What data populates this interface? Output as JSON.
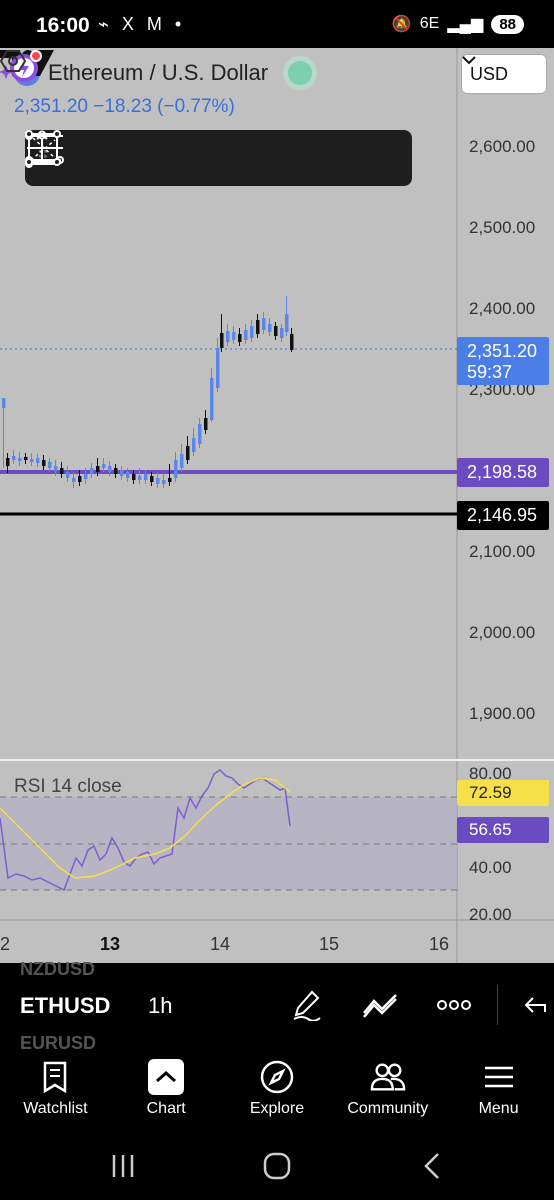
{
  "status_bar": {
    "time": "16:00",
    "left_icons": "⌁ X M •",
    "network": "6E",
    "battery": "88"
  },
  "symbol": {
    "title": "Ethereum / U.S. Dollar",
    "price_change": "2,351.20  −18.23 (−0.77%)",
    "currency": "USD"
  },
  "toolbar": {
    "tools": [
      "range-tool-icon",
      "fib-extension-icon",
      "parallel-lines-icon",
      "horizontal-ray-icon",
      "fib-channel-icon",
      "rectangle-icon"
    ]
  },
  "price_axis": {
    "labels": [
      "2,600.00",
      "2,500.00",
      "2,400.00",
      "2,300.00",
      "2,100.00",
      "2,000.00",
      "1,900.00"
    ],
    "current_price": "2,351.20",
    "countdown": "59:37",
    "line_purple": "2,198.58",
    "line_black": "2,146.95"
  },
  "rsi": {
    "label": "RSI 14 close",
    "axis_labels": [
      "80.00",
      "40.00",
      "20.00"
    ],
    "ma_value": "72.59",
    "rsi_value": "56.65"
  },
  "time_axis": {
    "labels": [
      "2",
      "13",
      "14",
      "15",
      "16"
    ]
  },
  "symbol_bar": {
    "ghost_top": "NZDUSD",
    "ticker": "ETHUSD",
    "interval": "1h",
    "ghost_bottom": "EURUSD"
  },
  "nav": {
    "items": [
      {
        "label": "Watchlist",
        "icon": "watchlist-icon"
      },
      {
        "label": "Chart",
        "icon": "chart-icon"
      },
      {
        "label": "Explore",
        "icon": "compass-icon"
      },
      {
        "label": "Community",
        "icon": "community-icon"
      },
      {
        "label": "Menu",
        "icon": "menu-icon"
      }
    ]
  },
  "colors": {
    "accent_blue": "#3b6ed8",
    "purple": "#6a4bc2",
    "rsi_ma": "#f5e04a"
  }
}
